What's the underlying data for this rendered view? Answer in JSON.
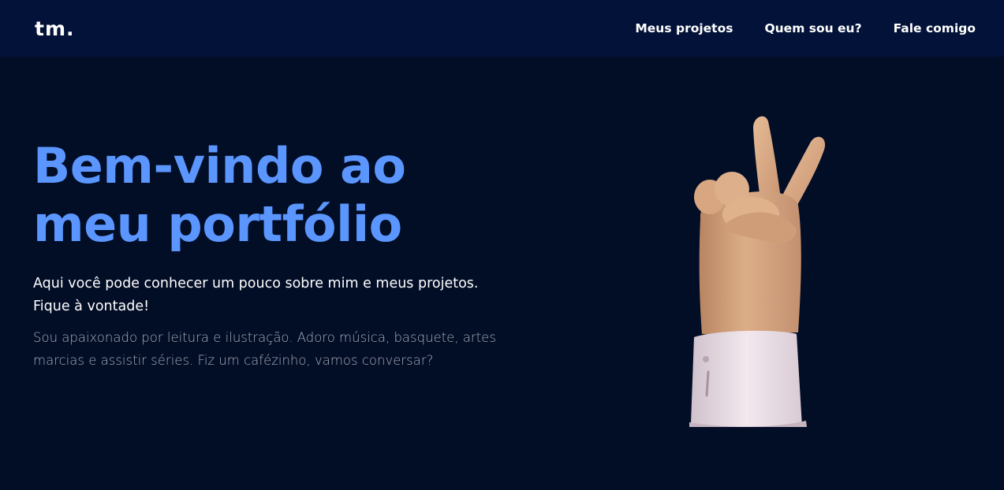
{
  "nav": {
    "logo": "tm.",
    "links": [
      {
        "label": "Meus projetos"
      },
      {
        "label": "Quem sou eu?"
      },
      {
        "label": "Fale comigo"
      }
    ]
  },
  "hero": {
    "title_lines": [
      "Bem-vindo ao",
      "meu portfólio"
    ],
    "subtitle_lines": [
      "Aqui você pode conhecer um pouco sobre mim e meus projetos.",
      "Fique à vontade!"
    ],
    "description": "Sou apaixonado por leitura e ilustração. Adoro música, basquete, artes marcias e assistir séries. Fiz um cafézinho, vamos conversar?",
    "illustration_icon": "peace-sign-hand-icon"
  },
  "colors": {
    "page_background": "#020d26",
    "navbar_background": "#031238",
    "accent": "#5b96ff",
    "text_primary": "#ffffff",
    "text_muted": "#a8adb8"
  }
}
